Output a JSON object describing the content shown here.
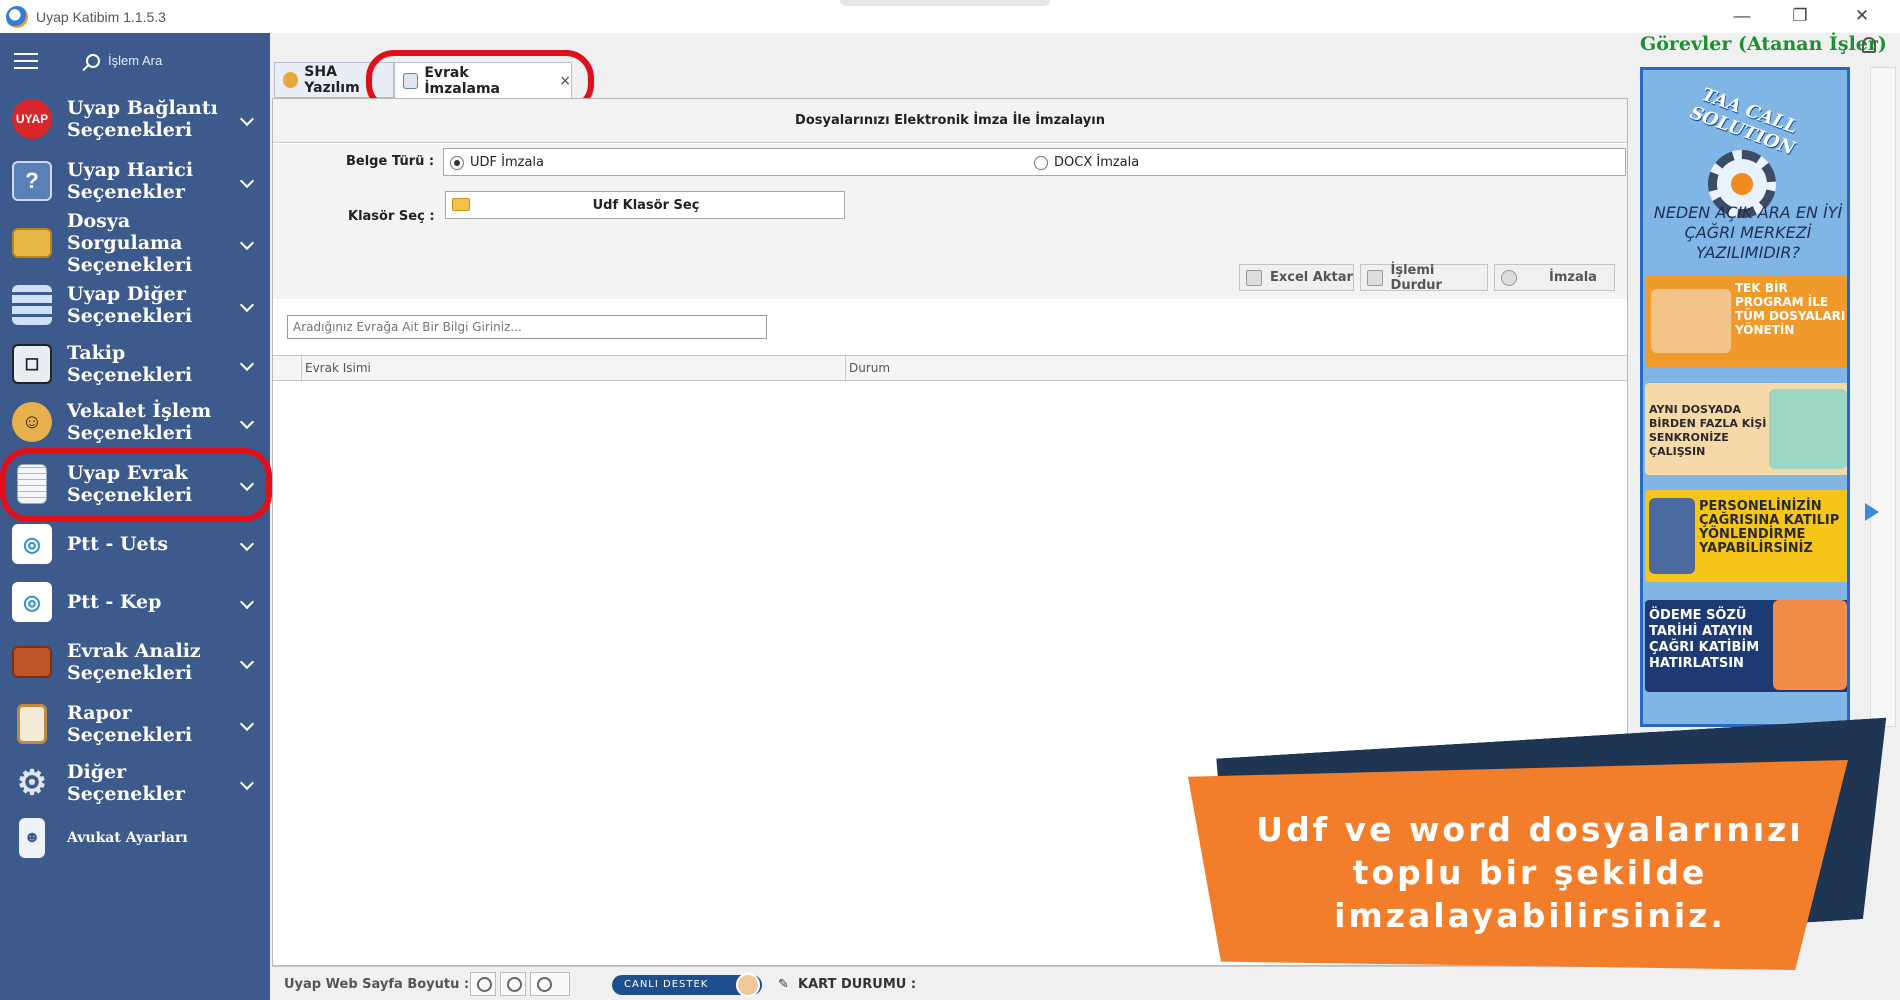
{
  "window": {
    "title": "Uyap Katibim 1.1.5.3",
    "minimize_glyph": "—",
    "restore_glyph": "❐",
    "close_glyph": "✕"
  },
  "sidebar": {
    "search_label": "İşlem Ara",
    "items": [
      {
        "label": "Uyap Bağlantı Seçenekleri",
        "icon": "uyap-logo-icon"
      },
      {
        "label": "Uyap Harici Seçenekler",
        "icon": "help-book-icon"
      },
      {
        "label": "Dosya Sorgulama Seçenekleri",
        "icon": "folder-icon"
      },
      {
        "label": "Uyap Diğer Seçenekleri",
        "icon": "grid-list-icon"
      },
      {
        "label": "Takip Seçenekleri",
        "icon": "target-frame-icon"
      },
      {
        "label": "Vekalet İşlem Seçenekleri",
        "icon": "user-handshake-icon"
      },
      {
        "label": "Uyap Evrak Seçenekleri",
        "icon": "document-icon"
      },
      {
        "label": "Ptt - Uets",
        "icon": "ptt-logo-icon"
      },
      {
        "label": "Ptt - Kep",
        "icon": "ptt-logo-icon"
      },
      {
        "label": "Evrak Analiz Seçenekleri",
        "icon": "briefcase-icon"
      },
      {
        "label": "Rapor Seçenekleri",
        "icon": "clipboard-icon"
      },
      {
        "label": "Diğer Seçenekler",
        "icon": "gear-icon"
      },
      {
        "label": "Avukat Ayarları",
        "icon": "lawyer-id-icon"
      }
    ]
  },
  "tabs": [
    {
      "label": "SHA Yazılım",
      "active": false
    },
    {
      "label": "Evrak İmzalama",
      "active": true,
      "close": "×"
    }
  ],
  "main": {
    "header": "Dosyalarınızı Elektronik İmza İle İmzalayın",
    "doc_type_label": "Belge Türü :",
    "radio_udf": "UDF İmzala",
    "radio_docx": "DOCX İmzala",
    "selected_type": "UDF İmzala",
    "folder_label": "Klasör Seç :",
    "folder_button": "Udf Klasör Seç",
    "btn_excel": "Excel Aktar",
    "btn_stop": "İşlemi Durdur",
    "btn_sign": "İmzala",
    "search_placeholder": "Aradığınız Evrağa Ait Bir Bilgi Giriniz...",
    "columns": [
      "Evrak Isimi",
      "Durum"
    ]
  },
  "status": {
    "web_size_label": "Uyap Web Sayfa Boyutu :",
    "live_support": "CANLI DESTEK",
    "card_status": "KART DURUMU :"
  },
  "right_panel": {
    "title": "Görevler (Atanan İşler)",
    "ad": {
      "brand": "TAA CALL SOLUTION",
      "question": "NEDEN AÇIK ARA EN İYİ ÇAĞRI MERKEZİ YAZILIMIDIR?",
      "panel1": "TEK BİR PROGRAM İLE TÜM DOSYALARI YÖNETİN",
      "panel2": "AYNI DOSYADA BİRDEN FAZLA KİŞİ SENKRONİZE ÇALIŞSIN",
      "panel3": "PERSONELİNİZİN ÇAĞRISINA KATILIP YÖNLENDİRME YAPABİLİRSİNİZ",
      "panel4": "ÖDEME SÖZÜ TARİHİ ATAYIN ÇAĞRI KATİBİM HATIRLATSIN"
    }
  },
  "promo": {
    "text": "Udf ve word dosyalarınızı toplu bir şekilde imzalayabilirsiniz."
  },
  "colors": {
    "sidebar_bg": "#3d5a8c",
    "highlight": "#e0101b",
    "tasks_title": "#1d8f30",
    "promo_bg": "#f27d2a",
    "promo_shadow": "#1f3554"
  }
}
